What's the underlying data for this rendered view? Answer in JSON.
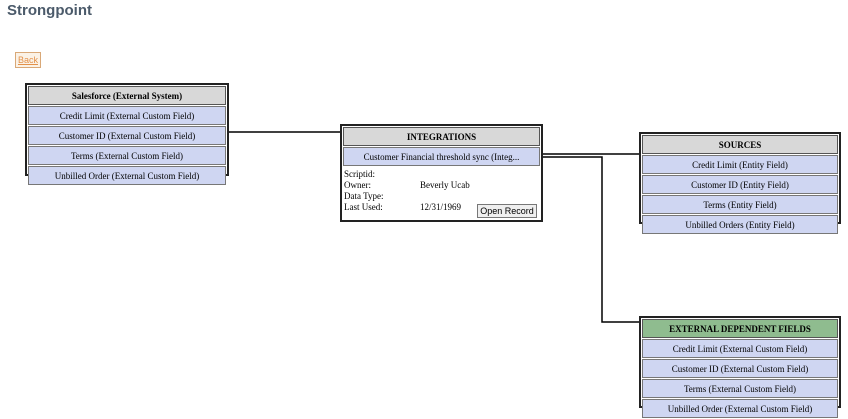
{
  "app": {
    "title": "Strongpoint"
  },
  "back_button": {
    "label": "Back"
  },
  "salesforce": {
    "header": "Salesforce (External System)",
    "items": [
      "Credit Limit (External Custom Field)",
      "Customer ID (External Custom Field)",
      "Terms (External Custom Field)",
      "Unbilled Order (External Custom Field)"
    ]
  },
  "integrations": {
    "header": "INTEGRATIONS",
    "record": "Customer Financial threshold sync (Integ...",
    "details": {
      "scriptid_label": "Scriptid:",
      "scriptid_value": "",
      "owner_label": "Owner:",
      "owner_value": "Beverly Ucab",
      "datatype_label": "Data Type:",
      "datatype_value": "",
      "lastused_label": "Last Used:",
      "lastused_value": "12/31/1969"
    },
    "open_button": "Open Record"
  },
  "sources": {
    "header": "SOURCES",
    "items": [
      "Credit Limit (Entity Field)",
      "Customer ID (Entity Field)",
      "Terms (Entity Field)",
      "Unbilled Orders (Entity Field)"
    ]
  },
  "external_dependent": {
    "header": "EXTERNAL DEPENDENT FIELDS",
    "items": [
      "Credit Limit (External Custom Field)",
      "Customer ID (External Custom Field)",
      "Terms (External Custom Field)",
      "Unbilled Order (External Custom Field)"
    ]
  },
  "colors": {
    "header_gray": "#d8d8d8",
    "header_green": "#8fbc8f",
    "row_blue": "#cfd6f2",
    "back_text": "#e3914a"
  }
}
